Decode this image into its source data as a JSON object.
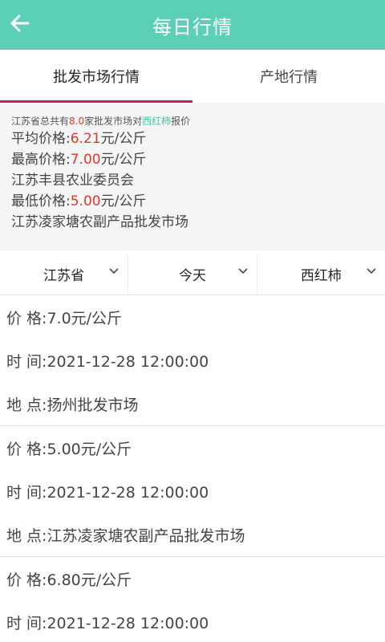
{
  "header": {
    "title": "每日行情",
    "back_icon": "arrow-left-icon"
  },
  "tabs": [
    {
      "label": "批发市场行情",
      "active": true
    },
    {
      "label": "产地行情",
      "active": false
    }
  ],
  "summary": {
    "intro_prefix": "江苏省总共有",
    "intro_count": "8.0",
    "intro_mid": "家批发市场对",
    "intro_product": "西红柿",
    "intro_suffix": "报价",
    "avg_label": "平均价格:",
    "avg_value": "6.21",
    "unit": "元/公斤",
    "max_label": "最高价格:",
    "max_value": "7.00",
    "max_market": "江苏丰县农业委员会",
    "min_label": "最低价格:",
    "min_value": "5.00",
    "min_market": "江苏凌家塘农副产品批发市场"
  },
  "filters": [
    {
      "label": "江苏省",
      "icon": "chevron-down-icon"
    },
    {
      "label": "今天",
      "icon": "chevron-down-icon"
    },
    {
      "label": "西红柿",
      "icon": "chevron-down-icon"
    }
  ],
  "records": [
    {
      "price": "价 格:7.0元/公斤",
      "time": "时 间:2021-12-28 12:00:00",
      "place": "地 点:扬州批发市场"
    },
    {
      "price": "价 格:5.00元/公斤",
      "time": "时 间:2021-12-28 12:00:00",
      "place": "地 点:江苏凌家塘农副产品批发市场"
    },
    {
      "price": "价 格:6.80元/公斤",
      "time": "时 间:2021-12-28 12:00:00",
      "place": ""
    }
  ],
  "colors": {
    "header": "#5ccfb7",
    "accent_teal": "#46c4aa",
    "price_red": "#e0382b",
    "tab_underline": "#b5295a"
  }
}
